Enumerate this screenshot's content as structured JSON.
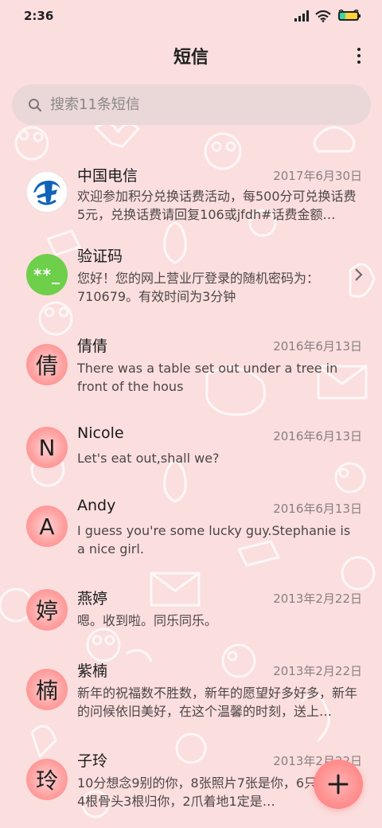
{
  "status_bar": {
    "time": "2:36",
    "icons": [
      "signal-icon",
      "wifi-icon",
      "battery-icon"
    ]
  },
  "header": {
    "title": "短信",
    "menu_icon": "more-vertical-icon"
  },
  "search": {
    "placeholder": "搜索11条短信",
    "icon": "search-icon"
  },
  "conversations": [
    {
      "name": "中国电信",
      "date": "2017年6月30日",
      "preview": "欢迎参加积分兑换话费活动，每500分可兑换话费5元，兑换话费请回复106或jfdh#话费金额…",
      "avatar_type": "telecom-logo-icon"
    },
    {
      "name": "验证码",
      "date": "",
      "preview": "您好！您的网上营业厅登录的随机密码为：710679。有效时间为3分钟",
      "avatar_text": "**_",
      "has_chevron": true
    },
    {
      "name": "倩倩",
      "date": "2016年6月13日",
      "preview": "There was a table set out under a tree in front of the hous",
      "avatar_text": "倩"
    },
    {
      "name": "Nicole",
      "date": "2016年6月13日",
      "preview": "Let's eat out,shall we?",
      "avatar_text": "N"
    },
    {
      "name": "Andy",
      "date": "2016年6月13日",
      "preview": "I guess you're some lucky guy.Stephanie is a nice girl.",
      "avatar_text": "A"
    },
    {
      "name": "燕婷",
      "date": "2013年2月22日",
      "preview": "嗯。收到啦。同乐同乐。",
      "avatar_text": "婷"
    },
    {
      "name": "紫楠",
      "date": "2013年2月22日",
      "preview": "新年的祝福数不胜数，新年的愿望好多好多，新年的问候依旧美好，在这个温馨的时刻，送上…",
      "avatar_text": "楠"
    },
    {
      "name": "子玲",
      "date": "2013年2月22日",
      "preview": "10分想念9别的你，8张照片7张是你，6只像你，4根骨头3根归你，2爪着地1定是…",
      "avatar_text": "玲"
    }
  ],
  "fab": {
    "icon": "plus-icon"
  },
  "colors": {
    "background": "#fbdede",
    "avatar": "#ff9e9e",
    "accent_green": "#6dcf4a"
  }
}
